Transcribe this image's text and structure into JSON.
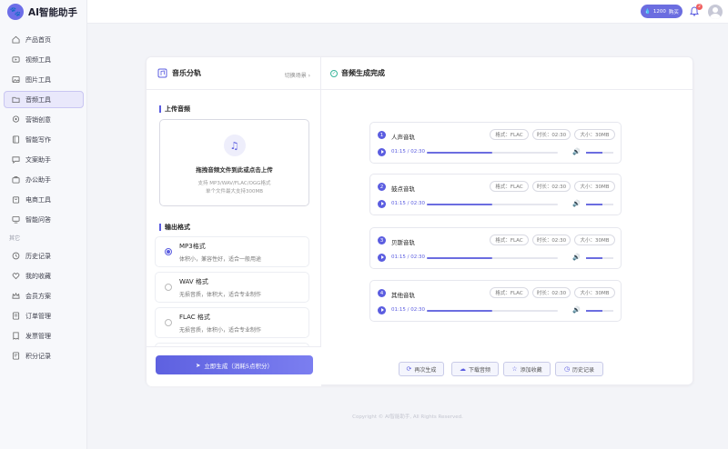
{
  "app": {
    "title": "AI智能助手",
    "logo_glyph": "🐾"
  },
  "sidebar": {
    "items": [
      {
        "label": "产品首页",
        "icon": "home-icon"
      },
      {
        "label": "视频工具",
        "icon": "video-icon"
      },
      {
        "label": "图片工具",
        "icon": "image-icon"
      },
      {
        "label": "音频工具",
        "icon": "folder-icon",
        "active": true
      },
      {
        "label": "营销创意",
        "icon": "location-icon"
      },
      {
        "label": "智能写作",
        "icon": "book-icon"
      },
      {
        "label": "文案助手",
        "icon": "chat-icon"
      },
      {
        "label": "办公助手",
        "icon": "briefcase-icon"
      },
      {
        "label": "电商工具",
        "icon": "cart-icon"
      },
      {
        "label": "智能问答",
        "icon": "screen-icon"
      }
    ],
    "section_label": "其它",
    "other_items": [
      {
        "label": "历史记录",
        "icon": "history-icon"
      },
      {
        "label": "我的收藏",
        "icon": "heart-icon"
      },
      {
        "label": "会员方案",
        "icon": "crown-icon"
      },
      {
        "label": "订单管理",
        "icon": "list-icon"
      },
      {
        "label": "发票管理",
        "icon": "invoice-icon"
      },
      {
        "label": "积分记录",
        "icon": "points-icon"
      }
    ]
  },
  "topbar": {
    "credits": "1200",
    "buy_label": "购买",
    "notification_count": "2"
  },
  "left_panel": {
    "title": "音乐分轨",
    "switch_label": "切换场景 ›",
    "upload_section": "上传音频",
    "upload_title": "拖拽音频文件到此或点击上传",
    "upload_formats": "支持 MP3/WAV/FLAC/OGG格式",
    "upload_limit": "单个文件最大支持300MB",
    "format_section": "输出格式",
    "formats": [
      {
        "name": "MP3格式",
        "desc": "体积小，兼容性好，适合一般用途",
        "selected": true
      },
      {
        "name": "WAV 格式",
        "desc": "无损音质，体积大，适合专业制作",
        "selected": false
      },
      {
        "name": "FLAC 格式",
        "desc": "无损音质，体积小，适合专业制作",
        "selected": false
      }
    ],
    "generate_label": "立即生成（消耗5点积分）"
  },
  "right_panel": {
    "title": "音频生成完成",
    "tracks": [
      {
        "num": "1",
        "name": "人声音轨",
        "format": "格式：FLAC",
        "duration": "时长：02:30",
        "size": "大小：30MB",
        "time": "01:15 / 02:30",
        "progress": 0.5
      },
      {
        "num": "2",
        "name": "鼓点音轨",
        "format": "格式：FLAC",
        "duration": "时长：02:30",
        "size": "大小：30MB",
        "time": "01:15 / 02:30",
        "progress": 0.5
      },
      {
        "num": "3",
        "name": "贝斯音轨",
        "format": "格式：FLAC",
        "duration": "时长：02:30",
        "size": "大小：30MB",
        "time": "01:15 / 02:30",
        "progress": 0.5
      },
      {
        "num": "4",
        "name": "其他音轨",
        "format": "格式：FLAC",
        "duration": "时长：02:30",
        "size": "大小：30MB",
        "time": "01:15 / 02:30",
        "progress": 0.5
      }
    ],
    "volume_level": 0.6,
    "actions": {
      "regenerate": "再次生成",
      "download": "下载音频",
      "favorite": "添加收藏",
      "history": "历史记录"
    }
  },
  "footer": "Copyright © AI智能助手, All Rights Reserved."
}
